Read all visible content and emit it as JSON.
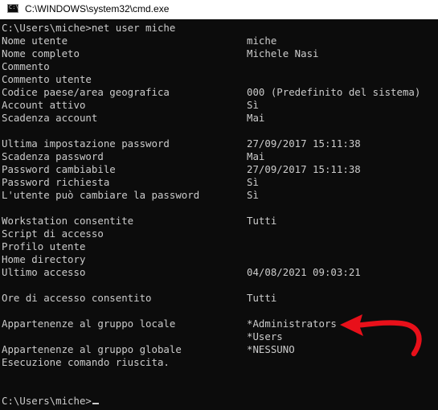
{
  "window": {
    "title": "C:\\WINDOWS\\system32\\cmd.exe",
    "icon": "cmd-icon",
    "icon_glyph": "C:\\"
  },
  "console": {
    "command_line": "C:\\Users\\miche>net user miche",
    "rows": [
      {
        "label": "Nome utente",
        "value": "miche"
      },
      {
        "label": "Nome completo",
        "value": "Michele Nasi"
      },
      {
        "label": "Commento",
        "value": ""
      },
      {
        "label": "Commento utente",
        "value": ""
      },
      {
        "label": "Codice paese/area geografica",
        "value": "000 (Predefinito del sistema)"
      },
      {
        "label": "Account attivo",
        "value": "Sì"
      },
      {
        "label": "Scadenza account",
        "value": "Mai"
      },
      {
        "label": "",
        "value": ""
      },
      {
        "label": "Ultima impostazione password",
        "value": "27/09/2017 15:11:38"
      },
      {
        "label": "Scadenza password",
        "value": "Mai"
      },
      {
        "label": "Password cambiabile",
        "value": "27/09/2017 15:11:38"
      },
      {
        "label": "Password richiesta",
        "value": "Sì"
      },
      {
        "label": "L'utente può cambiare la password",
        "value": "Sì"
      },
      {
        "label": "",
        "value": ""
      },
      {
        "label": "Workstation consentite",
        "value": "Tutti"
      },
      {
        "label": "Script di accesso",
        "value": ""
      },
      {
        "label": "Profilo utente",
        "value": ""
      },
      {
        "label": "Home directory",
        "value": ""
      },
      {
        "label": "Ultimo accesso",
        "value": "04/08/2021 09:03:21"
      },
      {
        "label": "",
        "value": ""
      },
      {
        "label": "Ore di accesso consentito",
        "value": "Tutti"
      },
      {
        "label": "",
        "value": ""
      },
      {
        "label": "Appartenenze al gruppo locale",
        "value": "*Administrators"
      },
      {
        "label": "",
        "value": "*Users"
      },
      {
        "label": "Appartenenze al gruppo globale",
        "value": "*NESSUNO"
      },
      {
        "label": "Esecuzione comando riuscita.",
        "value": ""
      },
      {
        "label": "",
        "value": ""
      },
      {
        "label": "",
        "value": ""
      }
    ],
    "final_prompt": "C:\\Users\\miche>"
  },
  "colors": {
    "console_background": "#0c0c0c",
    "console_text": "#cccccc",
    "annotation_arrow": "#e8101a"
  },
  "annotation": {
    "icon": "red-arrow-icon"
  }
}
